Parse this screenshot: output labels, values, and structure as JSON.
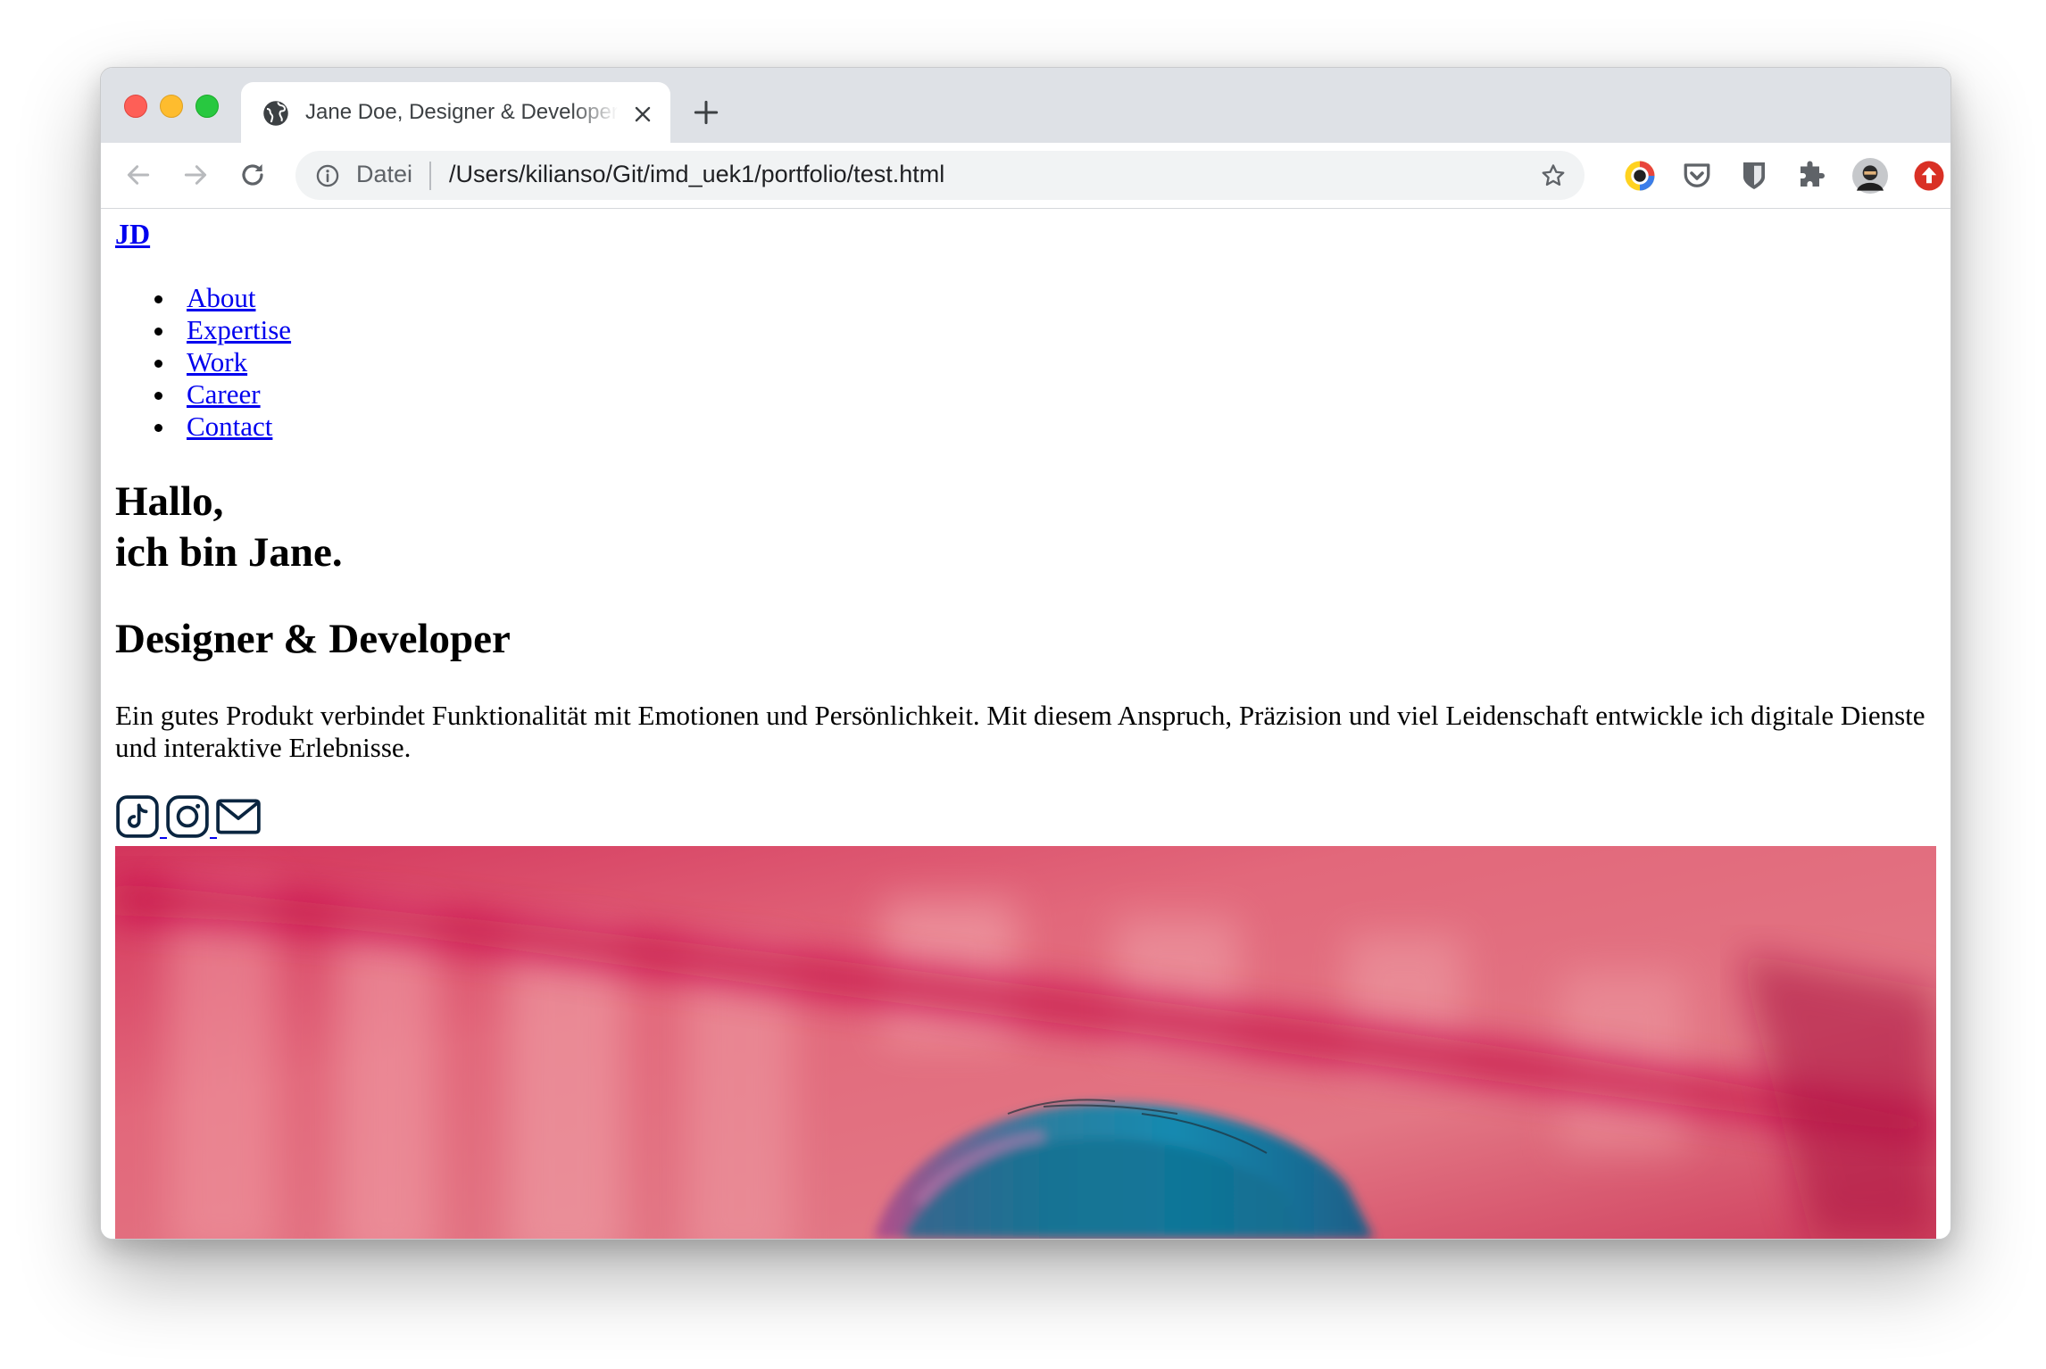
{
  "browser": {
    "tab": {
      "title": "Jane Doe, Designer & Developer",
      "favicon": "globe-icon"
    },
    "address_bar": {
      "scheme_label": "Datei",
      "url": "/Users/kilianso/Git/imd_uek1/portfolio/test.html"
    },
    "extensions": [
      "color-picker-icon",
      "pocket-icon",
      "bitwarden-icon",
      "extensions-puzzle-icon",
      "profile-avatar",
      "update-icon"
    ]
  },
  "page": {
    "logo": "JD",
    "nav": [
      "About",
      "Expertise",
      "Work",
      "Career",
      "Contact"
    ],
    "heading_line1": "Hallo,",
    "heading_line2": "ich bin Jane.",
    "subheading": "Designer & Developer",
    "intro": "Ein gutes Produkt verbindet Funktionalität mit Emotionen und Persönlichkeit. Mit diesem Anspruch, Präzision und viel Leidenschaft entwickle ich digitale Dienste und interaktive Erlebnisse.",
    "social_links": [
      "tiktok-icon",
      "instagram-icon",
      "mail-icon"
    ]
  },
  "colors": {
    "link": "#0000ee",
    "social_icon": "#0a2540",
    "hero_pink": "#d9576f",
    "hero_hair_blue": "#1a7a9a"
  }
}
